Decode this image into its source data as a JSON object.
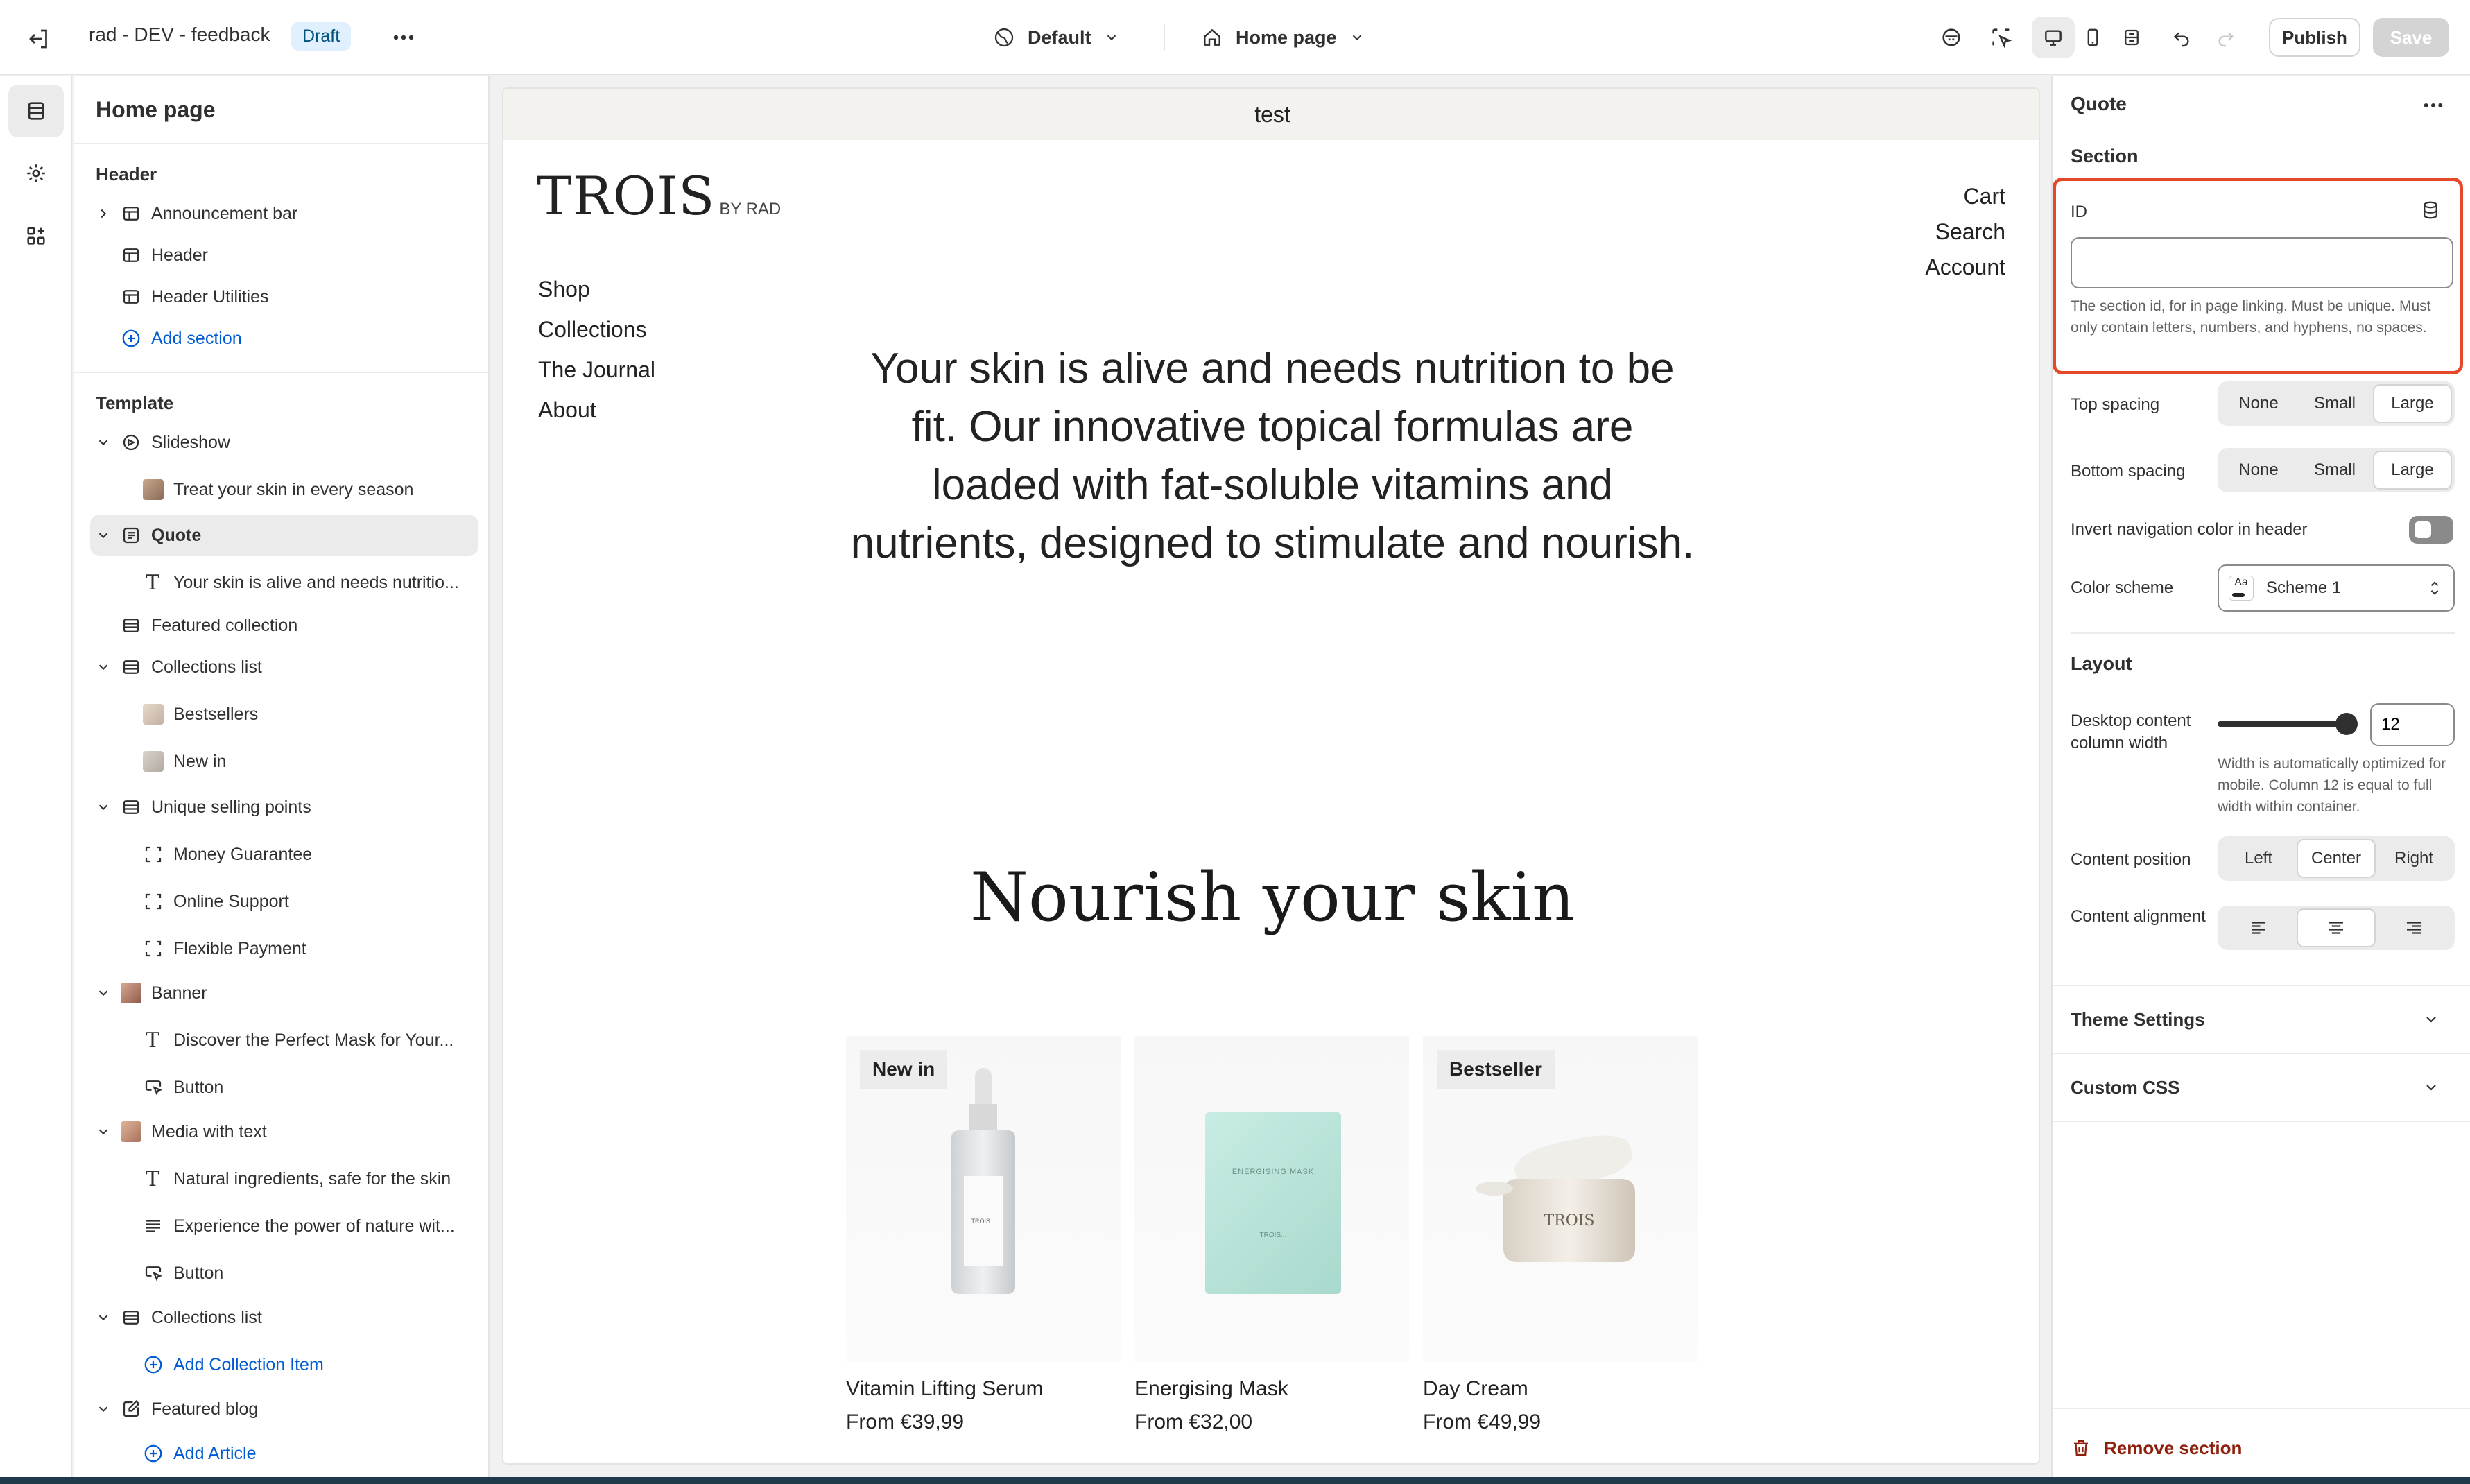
{
  "topbar": {
    "store_name": "rad - DEV - feedback",
    "status_badge": "Draft",
    "theme_selector": "Default",
    "page_selector": "Home page",
    "publish_label": "Publish",
    "save_label": "Save"
  },
  "left": {
    "title": "Home page",
    "header_group": "Header",
    "header_items": [
      "Announcement bar",
      "Header",
      "Header Utilities"
    ],
    "add_section": "Add section",
    "template_group": "Template",
    "tree": [
      {
        "label": "Slideshow"
      },
      {
        "label": "Treat your skin in every season"
      },
      {
        "label": "Quote"
      },
      {
        "label": "Your skin is alive and needs nutritio..."
      },
      {
        "label": "Featured collection"
      },
      {
        "label": "Collections list"
      },
      {
        "label": "Bestsellers"
      },
      {
        "label": "New in"
      },
      {
        "label": "Unique selling points"
      },
      {
        "label": "Money Guarantee"
      },
      {
        "label": "Online Support"
      },
      {
        "label": "Flexible Payment"
      },
      {
        "label": "Banner"
      },
      {
        "label": "Discover the Perfect Mask for Your..."
      },
      {
        "label": "Button"
      },
      {
        "label": "Media with text"
      },
      {
        "label": "Natural ingredients, safe for the skin"
      },
      {
        "label": "Experience the power of nature wit..."
      },
      {
        "label": "Button"
      },
      {
        "label": "Collections list"
      },
      {
        "label": "Add Collection Item"
      },
      {
        "label": "Featured blog"
      },
      {
        "label": "Add Article"
      }
    ]
  },
  "preview": {
    "announcement": "test",
    "logo": "TROIS",
    "logo_sub": "BY RAD",
    "nav": [
      "Shop",
      "Collections",
      "The Journal",
      "About"
    ],
    "util": [
      "Cart",
      "Search",
      "Account"
    ],
    "quote": "Your skin is alive and needs nutrition to be fit. Our innovative topical formulas are loaded with fat-soluble vitamins and nutrients, designed to stimulate and nourish.",
    "heading": "Nourish your skin",
    "products": [
      {
        "name": "Vitamin Lifting Serum",
        "price": "From €39,99",
        "badge": "New in",
        "label": "TROIS..."
      },
      {
        "name": "Energising Mask",
        "price": "From €32,00",
        "badge": "",
        "label": "ENERGISING MASK"
      },
      {
        "name": "Day Cream",
        "price": "From €49,99",
        "badge": "Bestseller",
        "label": "TROIS"
      }
    ],
    "mask_brand": "TROIS..."
  },
  "right": {
    "title": "Quote",
    "section_h": "Section",
    "id_label": "ID",
    "id_value": "",
    "id_help": "The section id, for in page linking. Must be unique. Must only contain letters, numbers, and hyphens, no spaces.",
    "top_spacing": "Top spacing",
    "bottom_spacing": "Bottom spacing",
    "spacing_opts": [
      "None",
      "Small",
      "Large"
    ],
    "spacing_top_selected": "Large",
    "spacing_bottom_selected": "Large",
    "invert_label": "Invert navigation color in header",
    "invert_on": false,
    "color_scheme_label": "Color scheme",
    "color_scheme_value": "Scheme 1",
    "color_scheme_swatch": "Aa",
    "layout_h": "Layout",
    "width_label": "Desktop content column width",
    "width_value": "12",
    "width_help": "Width is automatically optimized for mobile. Column 12 is equal to full width within container.",
    "position_label": "Content position",
    "position_opts": [
      "Left",
      "Center",
      "Right"
    ],
    "position_selected": "Center",
    "alignment_label": "Content alignment",
    "theme_settings": "Theme Settings",
    "custom_css": "Custom CSS",
    "remove": "Remove section"
  },
  "colors": {
    "accent": "#005bd3",
    "highlight": "#e5482a",
    "danger": "#8e1f0b",
    "badge_bg": "#e0f0ff"
  }
}
